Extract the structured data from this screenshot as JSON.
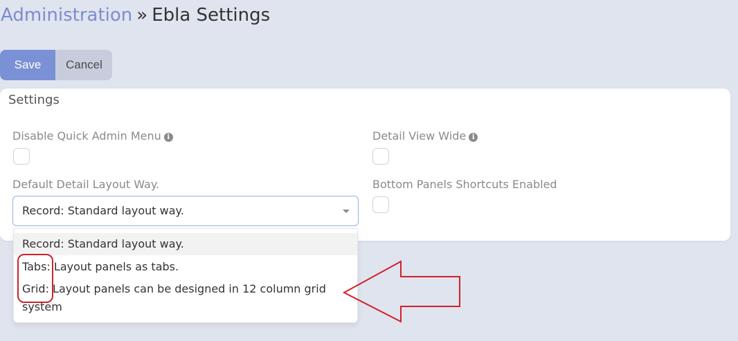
{
  "header": {
    "crumb_link": "Administration",
    "separator": "»",
    "title": "Ebla Settings"
  },
  "actions": {
    "save_label": "Save",
    "cancel_label": "Cancel"
  },
  "panel": {
    "heading": "Settings",
    "fields": {
      "disable_quick_admin_menu": "Disable Quick Admin Menu",
      "detail_view_wide": "Detail View Wide",
      "default_detail_layout_way": "Default Detail Layout Way.",
      "bottom_panels_shortcuts_enabled": "Bottom Panels Shortcuts Enabled"
    },
    "select_value": "Record: Standard layout way."
  },
  "dropdown": {
    "options": [
      "Record: Standard layout way.",
      "Tabs: Layout panels as tabs.",
      "Grid: Layout panels can be designed in 12 column grid system"
    ]
  },
  "icons": {
    "info": "info-icon",
    "caret": "chevron-down-icon"
  },
  "colors": {
    "accent": "#7b91d6",
    "annotation": "#d0202a"
  }
}
